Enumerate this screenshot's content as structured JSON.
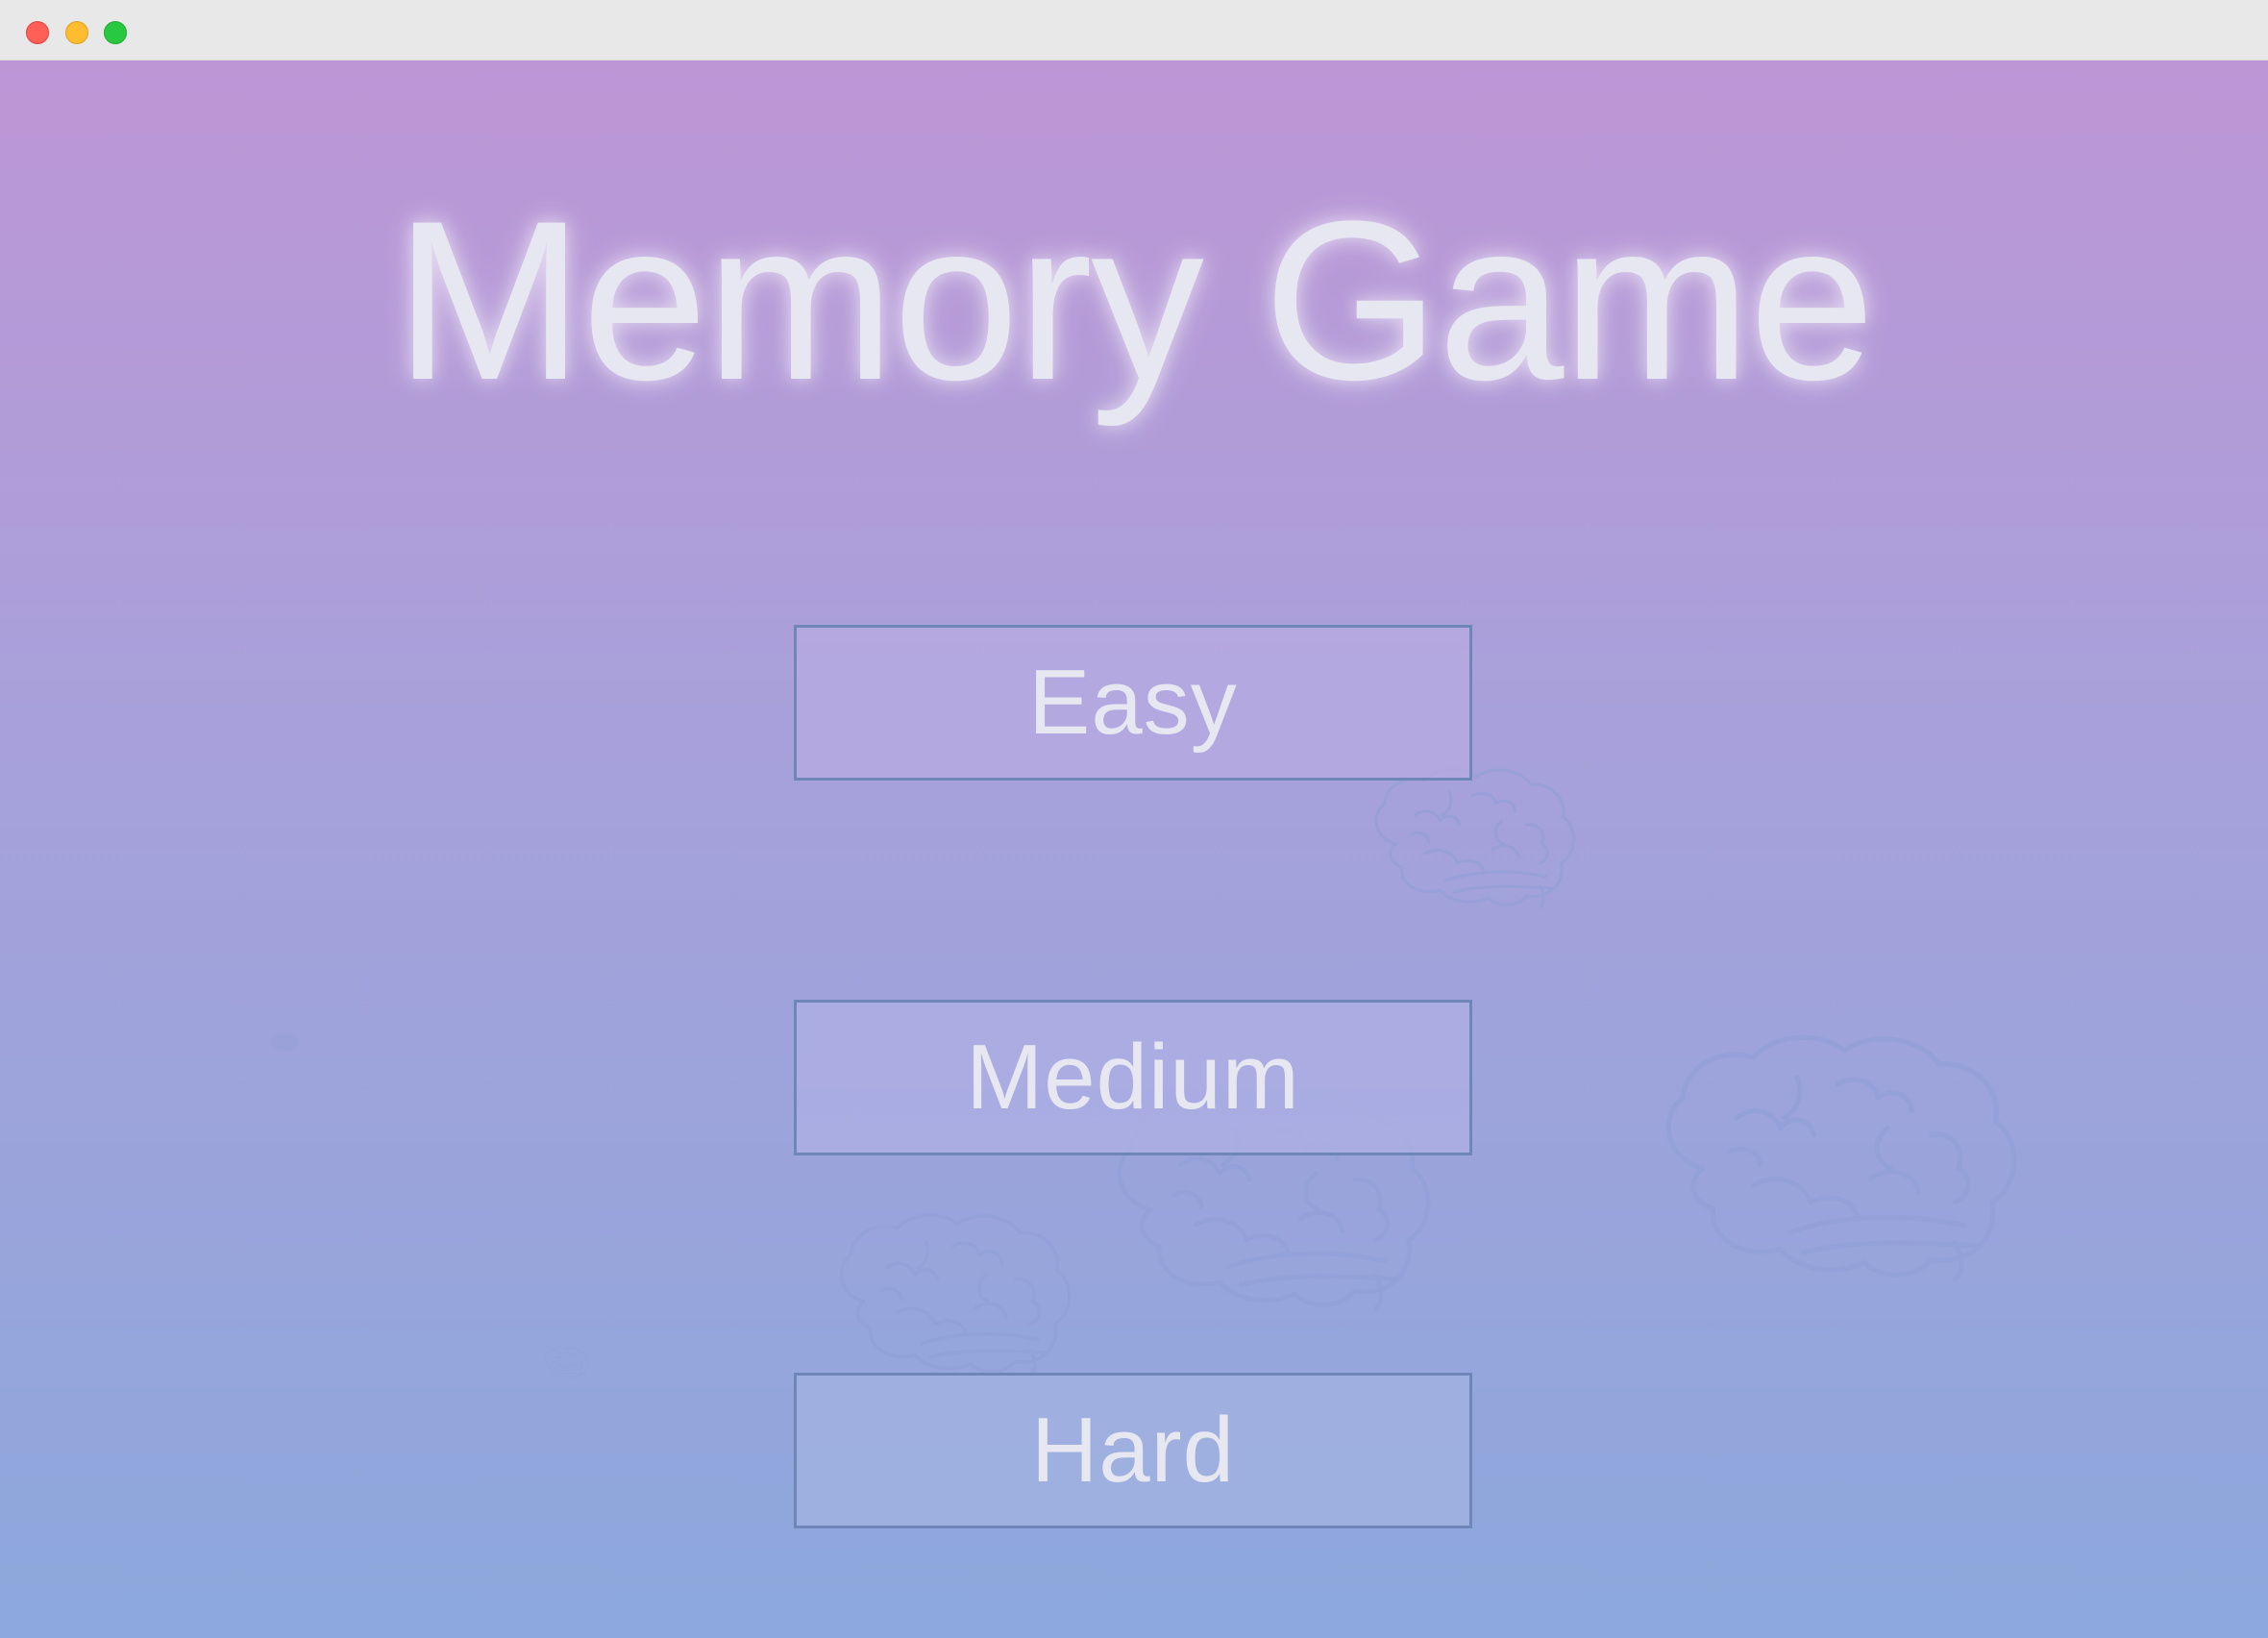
{
  "window": {
    "controls": [
      "close",
      "minimize",
      "maximize"
    ]
  },
  "game": {
    "title": "Memory Game",
    "difficulties": {
      "easy": "Easy",
      "medium": "Medium",
      "hard": "Hard"
    }
  },
  "decorations": {
    "icon": "brain-icon",
    "color": "#8f9fd6"
  },
  "colors": {
    "gradient_top": "#bd96d6",
    "gradient_bottom": "#8ca8dc",
    "text": "#e6e7f1",
    "button_border": "#6f86b8"
  }
}
